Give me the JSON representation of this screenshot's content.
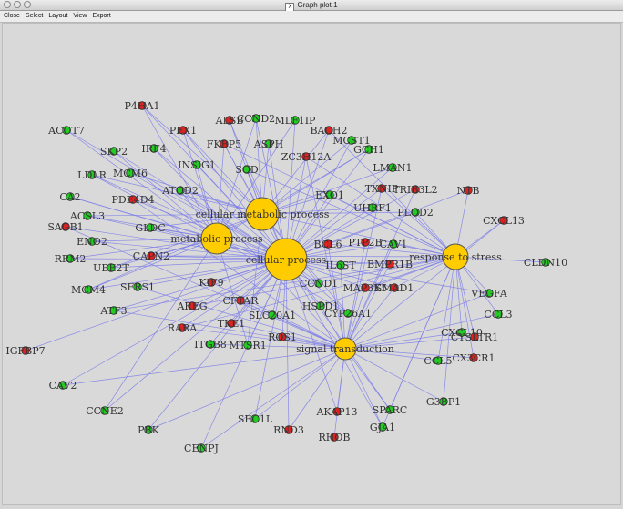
{
  "window": {
    "title": "Graph plot 1",
    "badge": "X"
  },
  "menu": [
    "Close",
    "Select",
    "Layout",
    "View",
    "Export"
  ],
  "colors": {
    "edge": "#7b7bea",
    "hub": "#ffcc00",
    "up": "#22cc22",
    "down": "#dd2222"
  },
  "hubs": [
    {
      "id": "cellular-process",
      "label": "cellular process"
    },
    {
      "id": "cellular-metabolic-process",
      "label": "cellular metabolic process"
    },
    {
      "id": "metabolic-process",
      "label": "metabolic process"
    },
    {
      "id": "response-to-stress",
      "label": "response to stress"
    },
    {
      "id": "signal-transduction",
      "label": "signal transduction"
    }
  ],
  "genes": [
    {
      "label": "P4HA1",
      "status": "down"
    },
    {
      "label": "ACOT7",
      "status": "up"
    },
    {
      "label": "PEX1",
      "status": "down"
    },
    {
      "label": "ALSB",
      "status": "down"
    },
    {
      "label": "CCND2",
      "status": "up"
    },
    {
      "label": "MLF1IP",
      "status": "up"
    },
    {
      "label": "BACH2",
      "status": "down"
    },
    {
      "label": "MCST1",
      "status": "up"
    },
    {
      "label": "SKP2",
      "status": "up"
    },
    {
      "label": "IRF4",
      "status": "up"
    },
    {
      "label": "FKBP5",
      "status": "down"
    },
    {
      "label": "ASPH",
      "status": "up"
    },
    {
      "label": "ZC3H12A",
      "status": "down"
    },
    {
      "label": "GCH1",
      "status": "up"
    },
    {
      "label": "LMAN1",
      "status": "up"
    },
    {
      "label": "LDLR",
      "status": "up"
    },
    {
      "label": "MCM6",
      "status": "up"
    },
    {
      "label": "INSIG1",
      "status": "up"
    },
    {
      "label": "SOD",
      "status": "up"
    },
    {
      "label": "TXNIP",
      "status": "down"
    },
    {
      "label": "TRIB3L2",
      "status": "down"
    },
    {
      "label": "NTB",
      "status": "down"
    },
    {
      "label": "CA2",
      "status": "up"
    },
    {
      "label": "PDE4D4",
      "status": "down"
    },
    {
      "label": "ATOD2",
      "status": "up"
    },
    {
      "label": "EXO1",
      "status": "up"
    },
    {
      "label": "UHRF1",
      "status": "up"
    },
    {
      "label": "PLOD2",
      "status": "up"
    },
    {
      "label": "CXCL13",
      "status": "down"
    },
    {
      "label": "ACSL3",
      "status": "up"
    },
    {
      "label": "GLDC",
      "status": "up"
    },
    {
      "label": "SAGB1",
      "status": "down"
    },
    {
      "label": "ENO2",
      "status": "up"
    },
    {
      "label": "BCL6",
      "status": "down"
    },
    {
      "label": "PTP2B",
      "status": "down"
    },
    {
      "label": "CAV1",
      "status": "up"
    },
    {
      "label": "RRM2",
      "status": "up"
    },
    {
      "label": "CAPN2",
      "status": "down"
    },
    {
      "label": "UBE2T",
      "status": "up"
    },
    {
      "label": "IL6ST",
      "status": "up"
    },
    {
      "label": "BMPR1B",
      "status": "down"
    },
    {
      "label": "CLDN10",
      "status": "up"
    },
    {
      "label": "MCM4",
      "status": "up"
    },
    {
      "label": "SFRS1",
      "status": "up"
    },
    {
      "label": "KIF9",
      "status": "down"
    },
    {
      "label": "CCND1",
      "status": "up"
    },
    {
      "label": "MAP3K5",
      "status": "down"
    },
    {
      "label": "SMAD1",
      "status": "down"
    },
    {
      "label": "VEGFA",
      "status": "up"
    },
    {
      "label": "ATF3",
      "status": "up"
    },
    {
      "label": "AREG",
      "status": "down"
    },
    {
      "label": "CFTAR",
      "status": "down"
    },
    {
      "label": "HSPD1",
      "status": "up"
    },
    {
      "label": "CYP26A1",
      "status": "up"
    },
    {
      "label": "CCL3",
      "status": "up"
    },
    {
      "label": "RARA",
      "status": "down"
    },
    {
      "label": "TKE1",
      "status": "down"
    },
    {
      "label": "SLC20A1",
      "status": "up"
    },
    {
      "label": "CXCL10",
      "status": "up"
    },
    {
      "label": "CYSLTR1",
      "status": "down"
    },
    {
      "label": "IGFBP7",
      "status": "down"
    },
    {
      "label": "ITGB8",
      "status": "up"
    },
    {
      "label": "MTSR1",
      "status": "up"
    },
    {
      "label": "ROS1",
      "status": "down"
    },
    {
      "label": "CCL5",
      "status": "up"
    },
    {
      "label": "CX3CR1",
      "status": "down"
    },
    {
      "label": "CAV2",
      "status": "up"
    },
    {
      "label": "CCNE2",
      "status": "up"
    },
    {
      "label": "SEC1L",
      "status": "up"
    },
    {
      "label": "AKAP13",
      "status": "down"
    },
    {
      "label": "SPARC",
      "status": "up"
    },
    {
      "label": "G3BP1",
      "status": "up"
    },
    {
      "label": "PBK",
      "status": "up"
    },
    {
      "label": "RND3",
      "status": "down"
    },
    {
      "label": "RHOB",
      "status": "down"
    },
    {
      "label": "GJA1",
      "status": "up"
    },
    {
      "label": "CENPJ",
      "status": "up"
    }
  ]
}
